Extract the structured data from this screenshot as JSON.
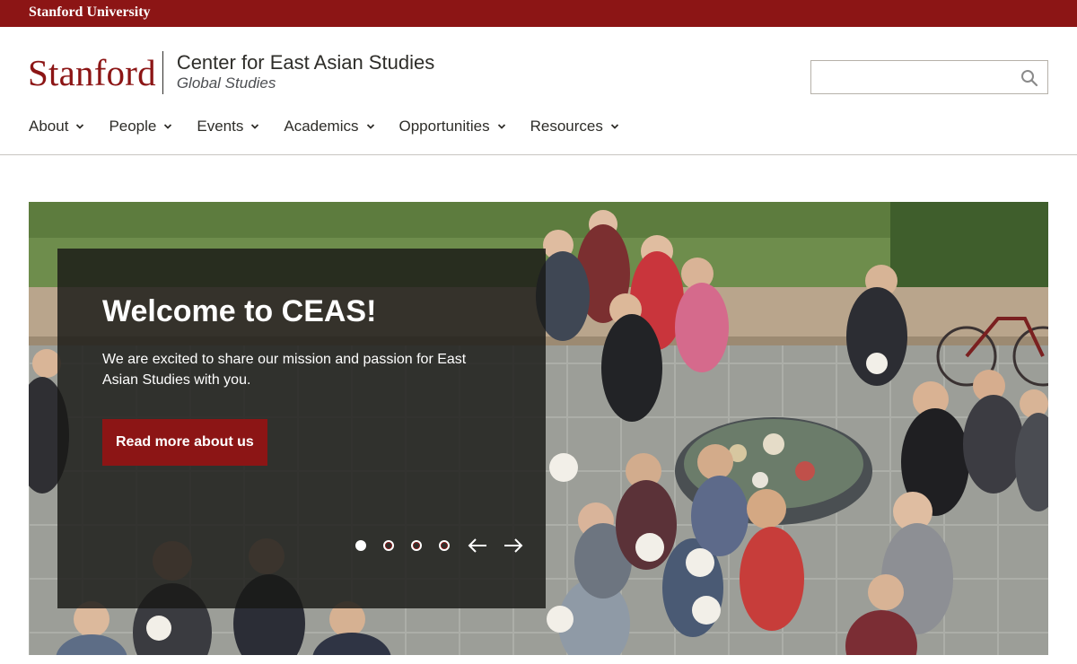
{
  "topbar": {
    "label": "Stanford University",
    "bg": "#8c1515"
  },
  "brand": {
    "wordmark": "Stanford",
    "title": "Center for East Asian Studies",
    "subtitle": "Global Studies"
  },
  "search": {
    "value": "",
    "placeholder": "",
    "icon": "search-icon"
  },
  "nav": [
    {
      "label": "About"
    },
    {
      "label": "People"
    },
    {
      "label": "Events"
    },
    {
      "label": "Academics"
    },
    {
      "label": "Opportunities"
    },
    {
      "label": "Resources"
    }
  ],
  "hero": {
    "title": "Welcome to CEAS!",
    "text": "We are excited to share our mission and passion for East Asian Studies with you.",
    "button": "Read more about us",
    "slides": 4,
    "active_slide": 1,
    "prev_icon": "arrow-left-icon",
    "next_icon": "arrow-right-icon"
  },
  "colors": {
    "cardinal": "#8c1515",
    "text": "#2e2d29"
  }
}
